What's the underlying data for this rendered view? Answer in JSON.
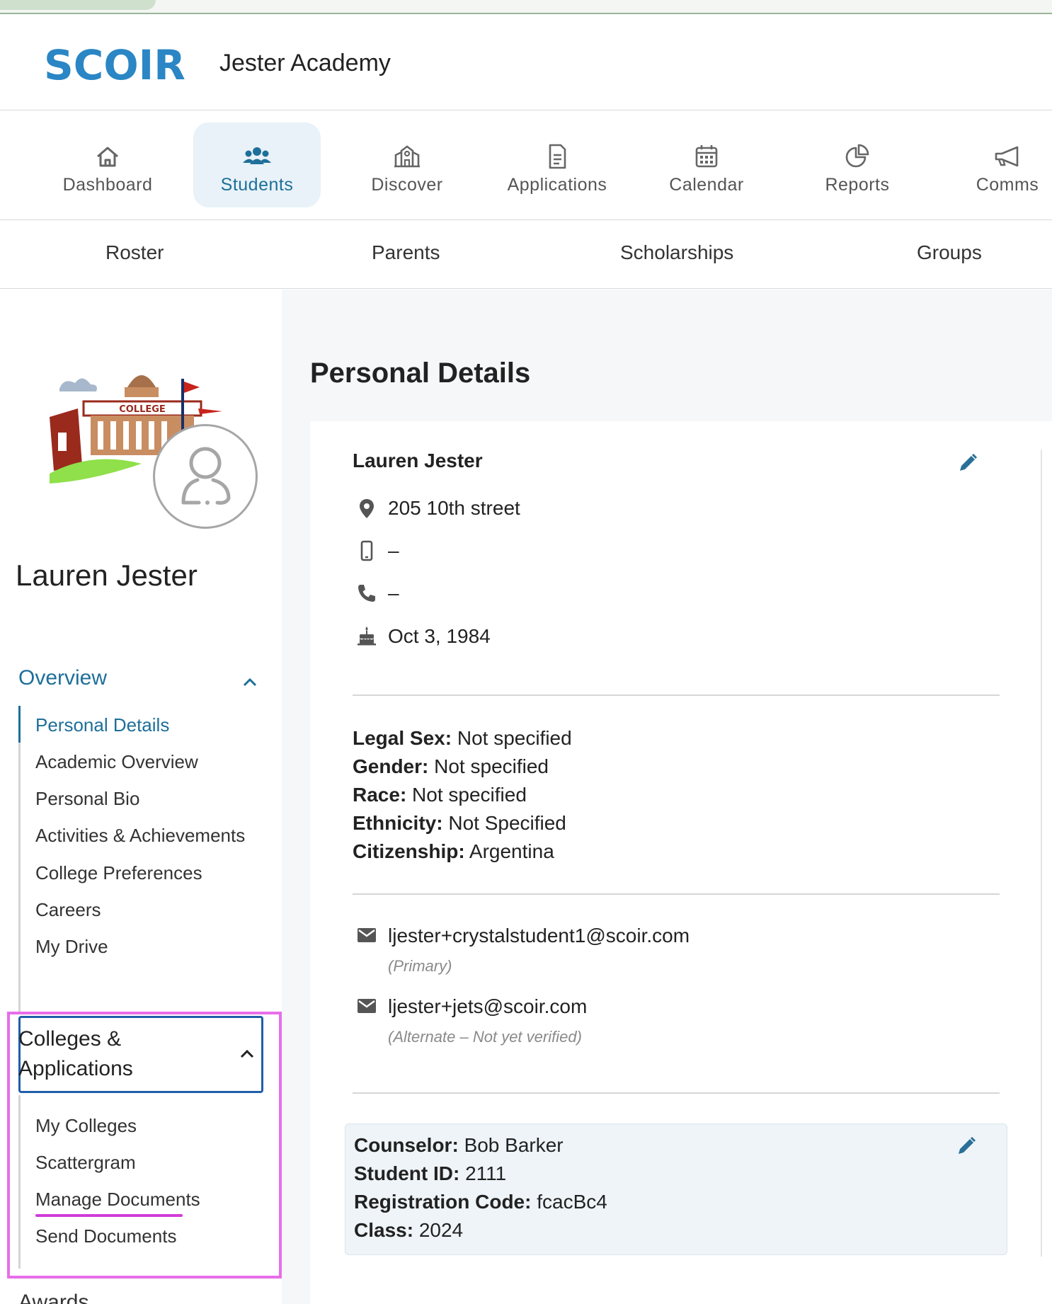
{
  "header": {
    "logo_text": "SCOIR",
    "school_name": "Jester Academy"
  },
  "colors": {
    "accent": "#1e6f99",
    "logo": "#2a86c4",
    "highlight": "#e86ee9",
    "focus": "#1f5ea8",
    "active_nav_bg": "#e8f2f8"
  },
  "main_nav": [
    {
      "label": "Dashboard",
      "icon": "home-icon",
      "active": false
    },
    {
      "label": "Students",
      "icon": "users-icon",
      "active": true
    },
    {
      "label": "Discover",
      "icon": "school-icon",
      "active": false
    },
    {
      "label": "Applications",
      "icon": "document-icon",
      "active": false
    },
    {
      "label": "Calendar",
      "icon": "calendar-icon",
      "active": false
    },
    {
      "label": "Reports",
      "icon": "pie-chart-icon",
      "active": false
    },
    {
      "label": "Comms",
      "icon": "megaphone-icon",
      "active": false
    }
  ],
  "sub_nav": [
    "Roster",
    "Parents",
    "Scholarships",
    "Groups"
  ],
  "sidebar": {
    "student_name": "Lauren Jester",
    "art_label": "COLLEGE",
    "overview": {
      "title": "Overview",
      "items": [
        "Personal Details",
        "Academic Overview",
        "Personal Bio",
        "Activities & Achievements",
        "College Preferences",
        "Careers",
        "My Drive"
      ],
      "selected": "Personal Details"
    },
    "colleges": {
      "title_line1": "Colleges &",
      "title_line2": "Applications",
      "items": [
        "My Colleges",
        "Scattergram",
        "Manage Documents",
        "Send Documents"
      ]
    },
    "next_section": "Awards"
  },
  "main": {
    "title": "Personal Details",
    "name": "Lauren Jester",
    "address": "205 10th street",
    "mobile": "–",
    "phone": "–",
    "birthday": "Oct 3, 1984",
    "attributes": [
      {
        "label": "Legal Sex:",
        "value": "Not specified"
      },
      {
        "label": "Gender:",
        "value": "Not specified"
      },
      {
        "label": "Race:",
        "value": "Not specified"
      },
      {
        "label": "Ethnicity:",
        "value": "Not Specified"
      },
      {
        "label": "Citizenship:",
        "value": "Argentina"
      }
    ],
    "emails": [
      {
        "address": "ljester+crystalstudent1@scoir.com",
        "note": "(Primary)"
      },
      {
        "address": "ljester+jets@scoir.com",
        "note": "(Alternate – Not yet verified)"
      }
    ],
    "school_info": [
      {
        "label": "Counselor:",
        "value": "Bob Barker"
      },
      {
        "label": "Student ID:",
        "value": "2111"
      },
      {
        "label": "Registration Code:",
        "value": "fcacBc4"
      },
      {
        "label": "Class:",
        "value": "2024"
      }
    ]
  }
}
